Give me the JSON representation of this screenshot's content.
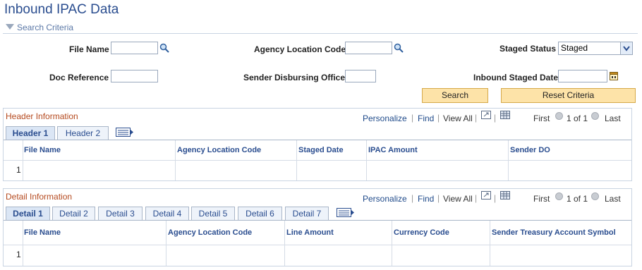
{
  "page": {
    "title": "Inbound IPAC Data"
  },
  "search_criteria": {
    "section_label": "Search Criteria",
    "file_name_label": "File Name",
    "agency_location_code_label": "Agency Location Code",
    "staged_status_label": "Staged Status",
    "staged_status_value": "Staged",
    "doc_reference_label": "Doc Reference",
    "sender_disbursing_office_label": "Sender Disbursing Office",
    "inbound_staged_date_label": "Inbound Staged Date",
    "search_button": "Search",
    "reset_button": "Reset Criteria"
  },
  "header_grid": {
    "title": "Header Information",
    "personalize": "Personalize",
    "find": "Find",
    "view_all": "View All",
    "first": "First",
    "range": "1 of 1",
    "last": "Last",
    "tabs": [
      {
        "label": "Header 1"
      },
      {
        "label": "Header 2"
      }
    ],
    "columns": [
      "File Name",
      "Agency Location Code",
      "Staged Date",
      "IPAC Amount",
      "Sender DO"
    ],
    "rows": [
      {
        "num": "1"
      }
    ]
  },
  "detail_grid": {
    "title": "Detail Information",
    "personalize": "Personalize",
    "find": "Find",
    "view_all": "View All",
    "first": "First",
    "range": "1 of 1",
    "last": "Last",
    "tabs": [
      {
        "label": "Detail 1"
      },
      {
        "label": "Detail 2"
      },
      {
        "label": "Detail 3"
      },
      {
        "label": "Detail 4"
      },
      {
        "label": "Detail 5"
      },
      {
        "label": "Detail 6"
      },
      {
        "label": "Detail 7"
      }
    ],
    "columns": [
      "File Name",
      "Agency Location Code",
      "Line Amount",
      "Currency Code",
      "Sender Treasury Account Symbol"
    ],
    "rows": [
      {
        "num": "1"
      }
    ]
  },
  "icons": {
    "lookup": "magnifier-icon",
    "calendar": "calendar-icon",
    "nav_prev": "arrow-left-icon",
    "nav_next": "arrow-right-icon",
    "show_all_tabs": "show-all-columns-icon",
    "zoom": "zoom-icon",
    "download": "download-icon"
  },
  "colors": {
    "title_blue": "#2a4d8f",
    "grid_title": "#b54a1f",
    "button_fill": "#fde3a8"
  }
}
